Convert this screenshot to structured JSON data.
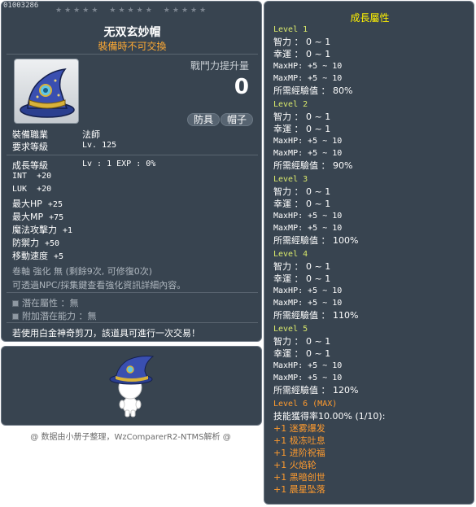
{
  "tooltip": {
    "item_code": "01003286",
    "title": "无双玄妙帽",
    "subtitle": "裝備時不可交換",
    "power_label": "戰鬥力提升量",
    "power_value": "0",
    "tags": [
      "防具",
      "帽子"
    ],
    "job_label": "裝備職業",
    "job_value": "法師",
    "level_label": "要求等級",
    "level_value": "Lv. 125",
    "growth_label": "成長等級",
    "growth_value": "Lv  :  1   EXP  :  0%",
    "stats": [
      {
        "name": "INT",
        "value": "+20"
      },
      {
        "name": "LUK",
        "value": "+20"
      },
      {
        "name": "最大HP",
        "value": "+25"
      },
      {
        "name": "最大MP",
        "value": "+75"
      },
      {
        "name": "魔法攻擊力",
        "value": "+1"
      },
      {
        "name": "防禦力",
        "value": "+50"
      },
      {
        "name": "移動速度",
        "value": "+5"
      }
    ],
    "upgrade_text": "卷軸 強化 無 (剩餘9次, 可修復0次)",
    "upgrade_hint": "可透過NPC/採集鍵查看強化資訊詳細內容。",
    "potential_label": "潛在屬性",
    "potential_value": "：無",
    "bonus_potential_label": "附加潛在能力",
    "bonus_potential_value": "：無",
    "trade_note": "若使用白金神奇剪刀，該道具可進行一次交易！"
  },
  "footer": "@ 数据由小册子整理，WzComparerR2-NTMS解析 @",
  "growth": {
    "title": "成長屬性",
    "levels": [
      {
        "label": "Level 1",
        "lines": [
          "智力 ： 0 ~ 1",
          "幸運 ： 0 ~ 1",
          "MaxHP:  +5 ~ 10",
          "MaxMP:  +5 ~ 10",
          "所需經驗值 ： 80%"
        ]
      },
      {
        "label": "Level 2",
        "lines": [
          "智力 ： 0 ~ 1",
          "幸運 ： 0 ~ 1",
          "MaxHP:  +5 ~ 10",
          "MaxMP:  +5 ~ 10",
          "所需經驗值 ： 90%"
        ]
      },
      {
        "label": "Level 3",
        "lines": [
          "智力 ： 0 ~ 1",
          "幸運 ： 0 ~ 1",
          "MaxHP:  +5 ~ 10",
          "MaxMP:  +5 ~ 10",
          "所需經驗值 ： 100%"
        ]
      },
      {
        "label": "Level 4",
        "lines": [
          "智力 ： 0 ~ 1",
          "幸運 ： 0 ~ 1",
          "MaxHP:  +5 ~ 10",
          "MaxMP:  +5 ~ 10",
          "所需經驗值 ： 110%"
        ]
      },
      {
        "label": "Level 5",
        "lines": [
          "智力 ： 0 ~ 1",
          "幸運 ： 0 ~ 1",
          "MaxHP:  +5 ~ 10",
          "MaxMP:  +5 ~ 10",
          "所需經驗值 ： 120%"
        ]
      }
    ],
    "max_level_label": "Level 6 (MAX)",
    "skill_rate": "技能獲得率10.00% (1/10):",
    "skills": [
      "+1 迷雾爆发",
      "+1 极冻吐息",
      "+1 进阶祝福",
      "+1 火焰轮",
      "+1 黑暗创世",
      "+1 晨星坠落"
    ]
  },
  "colors": {
    "panel_bg": "#384450",
    "subtitle": "#ffaa33",
    "growth_title": "#fff200",
    "level_label": "#d9e96b",
    "skill_text": "#ff9b2e"
  }
}
